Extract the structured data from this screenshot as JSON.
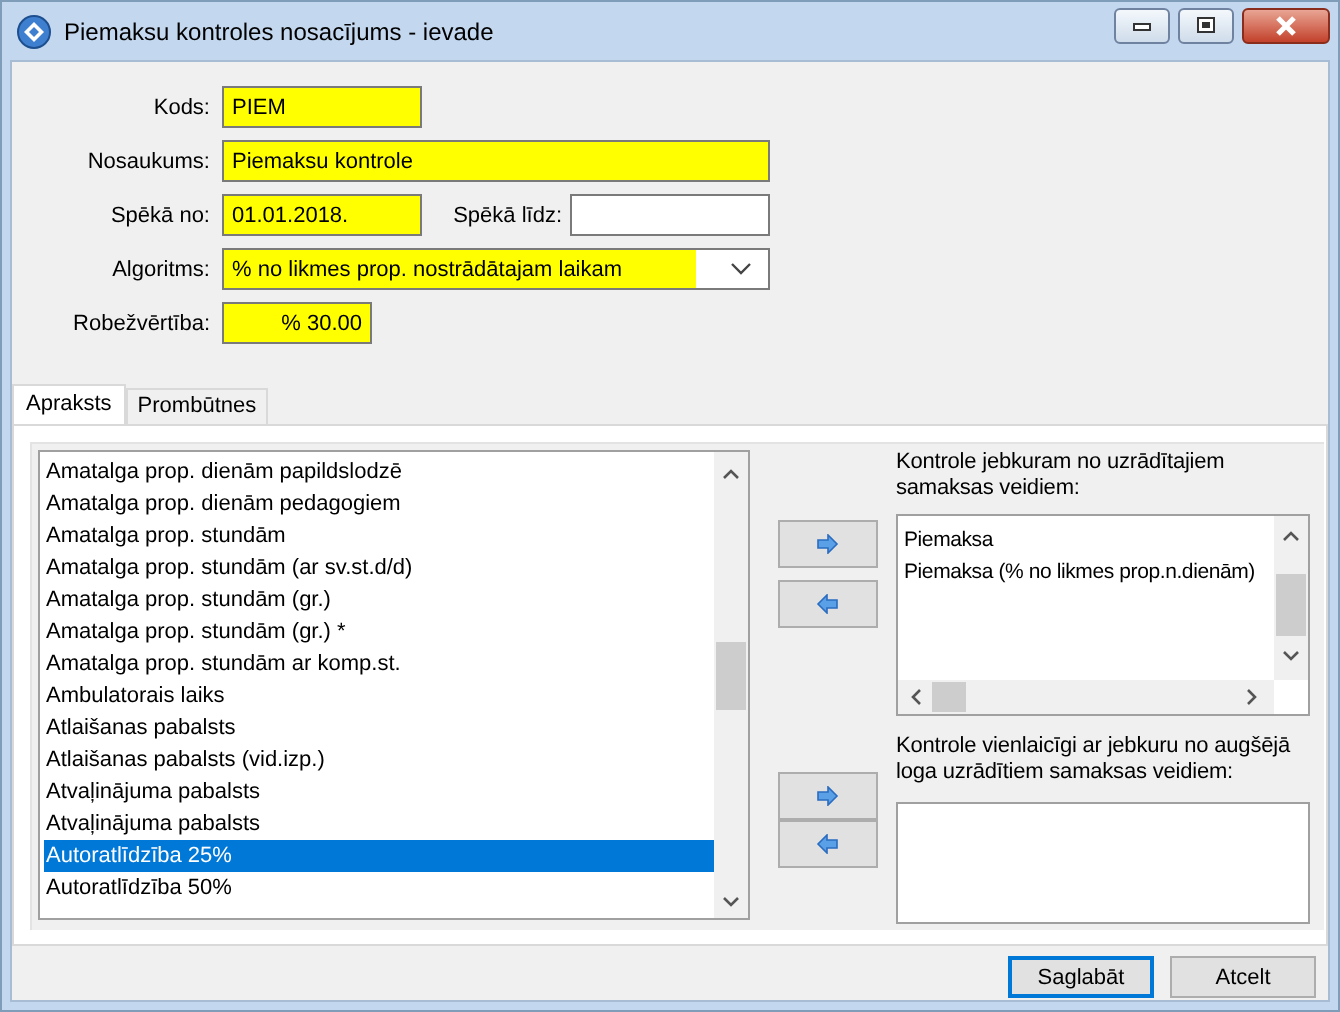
{
  "window": {
    "title": "Piemaksu kontroles nosacījums - ievade"
  },
  "form": {
    "rows": [
      {
        "fields": [
          {
            "label": "Kods:",
            "value": "PIEM",
            "kind": "text",
            "required": true
          }
        ]
      },
      {
        "fields": [
          {
            "label": "Nosaukums:",
            "value": "Piemaksu kontrole",
            "kind": "text",
            "required": true
          }
        ]
      },
      {
        "fields": [
          {
            "label": "Spēkā no:",
            "value": "01.01.2018.",
            "kind": "text",
            "required": true
          },
          {
            "label": "Spēkā līdz:",
            "kind": "text",
            "required": false
          }
        ]
      },
      {
        "fields": [
          {
            "label": "Algoritms:",
            "value": "% no likmes prop. nostrādātajam laikam",
            "kind": "dropdown",
            "required": true
          }
        ]
      },
      {
        "fields": [
          {
            "label": "Robežvērtība:",
            "value": "% 30.00",
            "kind": "number",
            "required": true
          }
        ]
      }
    ]
  },
  "tabs": [
    {
      "label": "Apraksts",
      "selected": true
    },
    {
      "label": "Prombūtnes",
      "selected": false
    }
  ],
  "available": {
    "items": [
      {
        "label": "Amatalga prop. dienām papildslodzē",
        "selected": false
      },
      {
        "label": "Amatalga prop. dienām pedagogiem",
        "selected": false
      },
      {
        "label": "Amatalga prop. stundām",
        "selected": false
      },
      {
        "label": "Amatalga prop. stundām (ar sv.st.d/d)",
        "selected": false
      },
      {
        "label": "Amatalga prop. stundām (gr.)",
        "selected": false
      },
      {
        "label": "Amatalga prop. stundām (gr.) *",
        "selected": false
      },
      {
        "label": "Amatalga prop. stundām ar komp.st.",
        "selected": false
      },
      {
        "label": "Ambulatorais laiks",
        "selected": false
      },
      {
        "label": "Atlaišanas pabalsts",
        "selected": false
      },
      {
        "label": "Atlaišanas pabalsts (vid.izp.)",
        "selected": false
      },
      {
        "label": "Atvaļinājuma  pabalsts",
        "selected": false
      },
      {
        "label": "Atvaļinājuma  pabalsts",
        "selected": false
      },
      {
        "label": "Autoratlīdzība 25%",
        "selected": true
      },
      {
        "label": "Autoratlīdzība 50%",
        "selected": false
      }
    ]
  },
  "assigned": {
    "label": "Kontrole jebkuram no uzrādītajiem samaksas veidiem:",
    "items": [
      "Piemaksa",
      "Piemaksa (% no likmes prop.n.dienām)"
    ]
  },
  "concurrent": {
    "label": "Kontrole vienlaicīgi ar jebkuru no augšējā loga uzrādītiem samaksas veidiem:"
  },
  "buttons": [
    {
      "label": "Saglabāt",
      "default": true
    },
    {
      "label": "Atcelt",
      "default": false
    }
  ]
}
